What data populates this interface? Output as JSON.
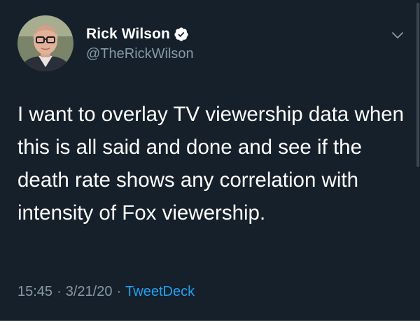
{
  "author": {
    "display_name": "Rick Wilson",
    "handle": "@TheRickWilson",
    "verified": true
  },
  "tweet": {
    "text": "I want to overlay TV viewership data when this is all said and done and see if the death rate shows any correlation with intensity of Fox viewership.",
    "time": "15:45",
    "date": "3/21/20",
    "separator": "·",
    "source": "TweetDeck"
  },
  "icons": {
    "verified": "verified-badge-icon",
    "more": "chevron-down-icon"
  },
  "colors": {
    "background": "#15202b",
    "text": "#ffffff",
    "secondary_text": "#8899a6",
    "accent": "#1da1f2"
  }
}
